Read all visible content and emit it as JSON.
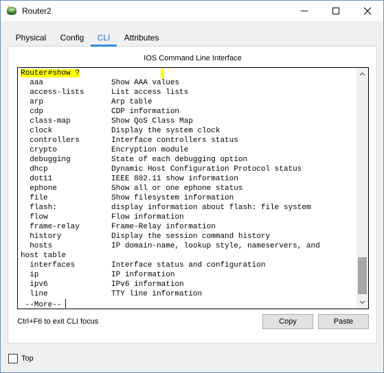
{
  "window": {
    "title": "Router2",
    "icon": "router-icon",
    "controls": [
      "minimize-icon",
      "maximize-icon",
      "close-icon"
    ]
  },
  "tabs": [
    {
      "label": "Physical",
      "active": false
    },
    {
      "label": "Config",
      "active": false
    },
    {
      "label": "CLI",
      "active": true
    },
    {
      "label": "Attributes",
      "active": false
    }
  ],
  "panel_title": "IOS Command Line Interface",
  "terminal": {
    "prompt": "Router#show ?",
    "lines": [
      "  aaa               Show AAA values",
      "  access-lists      List access lists",
      "  arp               Arp table",
      "  cdp               CDP information",
      "  class-map         Show QoS Class Map",
      "  clock             Display the system clock",
      "  controllers       Interface controllers status",
      "  crypto            Encryption module",
      "  debugging         State of each debugging option",
      "  dhcp              Dynamic Host Configuration Protocol status",
      "  dot11             IEEE 802.11 show information",
      "  ephone            Show all or one ephone status",
      "  file              Show filesystem information",
      "  flash:            display information about flash: file system",
      "  flow              Flow information",
      "  frame-relay       Frame-Relay information",
      "  history           Display the session command history",
      "  hosts             IP domain-name, lookup style, nameservers, and",
      "host table",
      "  interfaces        Interface status and configuration",
      "  ip                IP information",
      "  ipv6              IPv6 information",
      "  line              TTY line information"
    ],
    "more": " --More--"
  },
  "hint": "Ctrl+F6 to exit CLI focus",
  "buttons": {
    "copy": "Copy",
    "paste": "Paste"
  },
  "top_checkbox": {
    "label": "Top",
    "checked": false
  }
}
